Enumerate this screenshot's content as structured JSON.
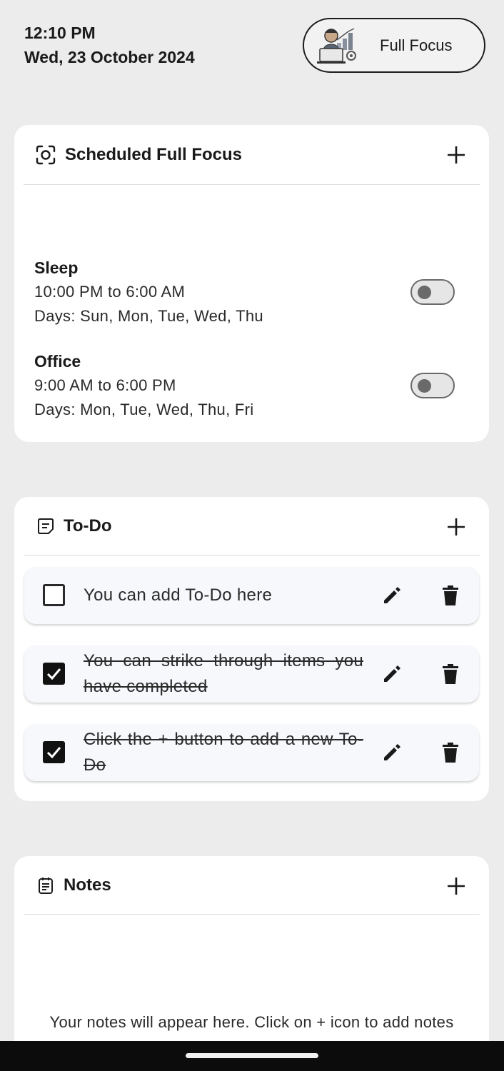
{
  "status": {
    "time": "12:10 PM",
    "date": "Wed, 23 October 2024"
  },
  "focus_button": {
    "label": "Full Focus",
    "icon": "person-at-laptop-illustration"
  },
  "scheduled": {
    "title": "Scheduled Full Focus",
    "icon": "focus-target-icon",
    "items": [
      {
        "name": "Sleep",
        "time": "10:00 PM to 6:00 AM",
        "days": "Days: Sun, Mon, Tue, Wed, Thu",
        "enabled": false
      },
      {
        "name": "Office",
        "time": "9:00 AM to 6:00 PM",
        "days": "Days: Mon, Tue, Wed, Thu, Fri",
        "enabled": false
      }
    ]
  },
  "todo": {
    "title": "To-Do",
    "icon": "note-icon",
    "items": [
      {
        "text": "You can add To-Do here",
        "done": false
      },
      {
        "text": "You can strike through items you have completed",
        "done": true
      },
      {
        "text": "Click the + button to add a new To-Do",
        "done": true
      }
    ]
  },
  "notes": {
    "title": "Notes",
    "icon": "notes-list-icon",
    "empty_text": "Your notes will appear here. Click on + icon to add notes"
  },
  "colors": {
    "background": "#ececec",
    "card": "#ffffff",
    "text": "#1a1a1a",
    "checked": "#111111"
  }
}
